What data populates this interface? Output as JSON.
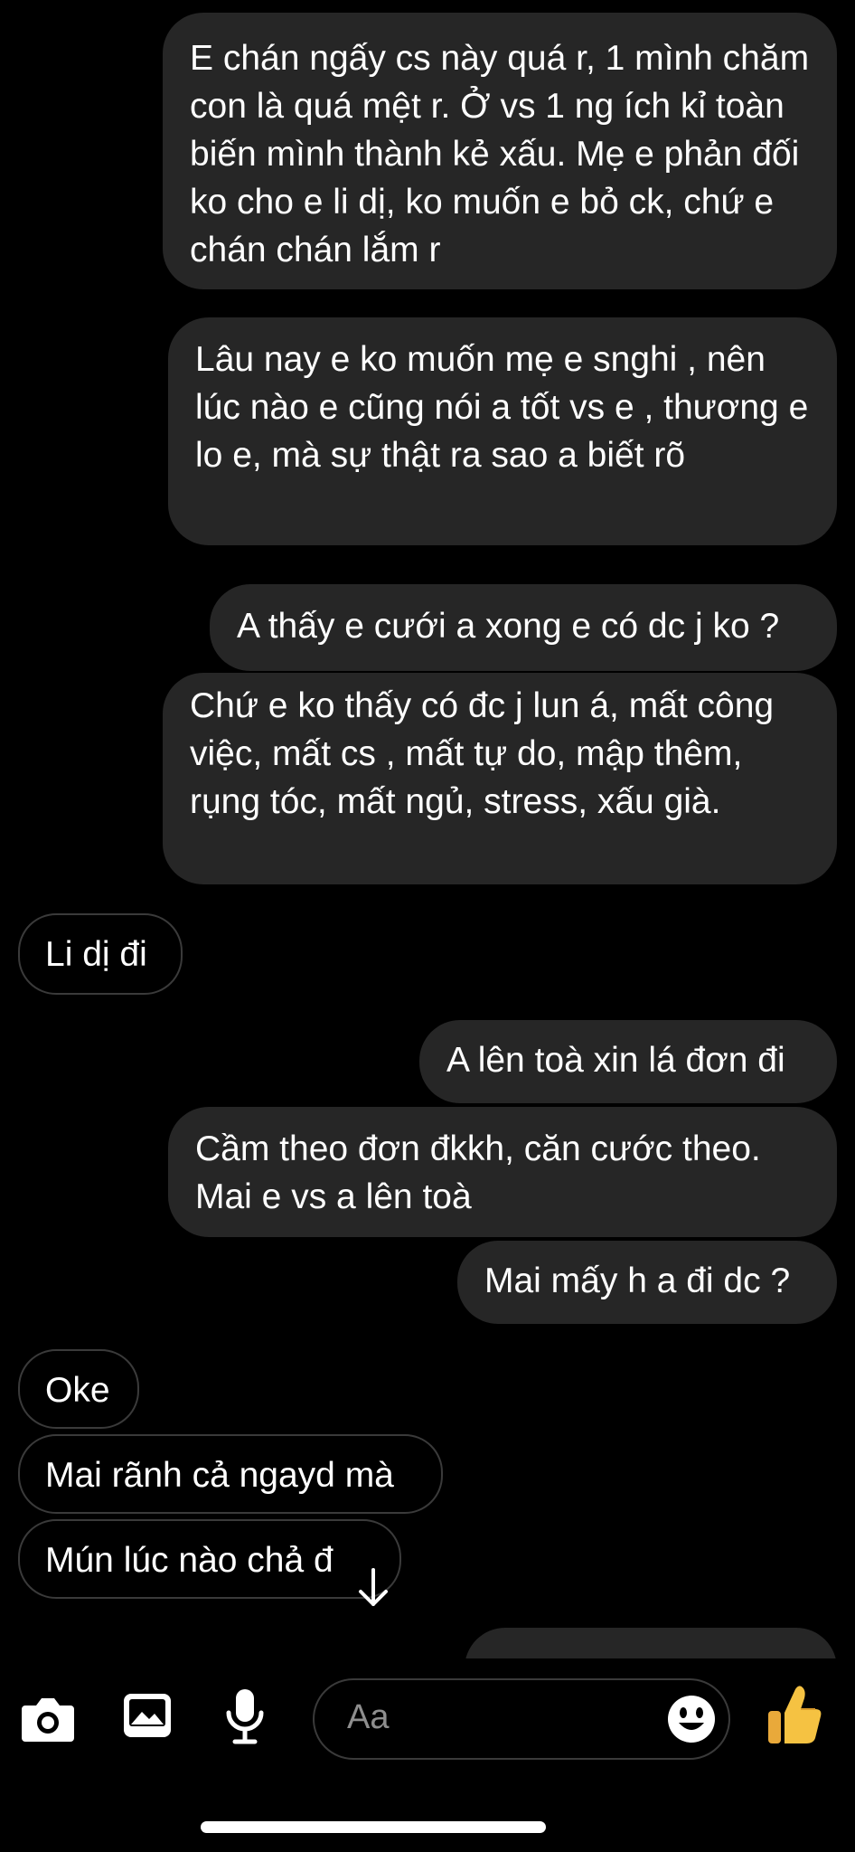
{
  "messages": [
    {
      "side": "out",
      "text": "E chán ngấy cs này quá r, 1 mình chăm con là quá mệt r. Ở vs 1 ng ích kỉ toàn biến mình thành kẻ xấu. Mẹ e phản đối ko cho e li dị, ko muốn e bỏ ck, chứ e chán chán lắm r"
    },
    {
      "side": "out",
      "text": "Lâu nay e ko muốn mẹ e snghi , nên lúc nào e cũng nói a tốt vs e , thương e lo e, mà sự thật ra sao a biết rõ"
    },
    {
      "side": "out",
      "text": "A thấy e cưới a xong e có dc j ko ?"
    },
    {
      "side": "out",
      "text": "Chứ e ko thấy có đc j lun á, mất công việc, mất cs , mất tự do, mập thêm, rụng tóc, mất ngủ, stress, xấu già."
    },
    {
      "side": "in",
      "text": "Li dị đi"
    },
    {
      "side": "out",
      "text": "A lên toà xin lá đơn đi"
    },
    {
      "side": "out",
      "text": "Cầm theo đơn đkkh, căn cước theo. Mai e vs a lên toà"
    },
    {
      "side": "out",
      "text": "Mai mấy h a đi dc ?"
    },
    {
      "side": "in",
      "text": "Oke"
    },
    {
      "side": "in",
      "text": "Mai rãnh cả ngayd mà"
    },
    {
      "side": "in",
      "text": "Mún lúc nào chả đ"
    }
  ],
  "composer": {
    "placeholder": "Aa",
    "icons": [
      "camera-icon",
      "photo-icon",
      "microphone-icon",
      "emoji-icon",
      "thumbs-up-icon"
    ]
  },
  "colors": {
    "background": "#000000",
    "outgoing_bubble": "#262626",
    "incoming_border": "#3a3a3a",
    "placeholder": "#8e8e8e",
    "like_yellow": "#f5c242"
  }
}
